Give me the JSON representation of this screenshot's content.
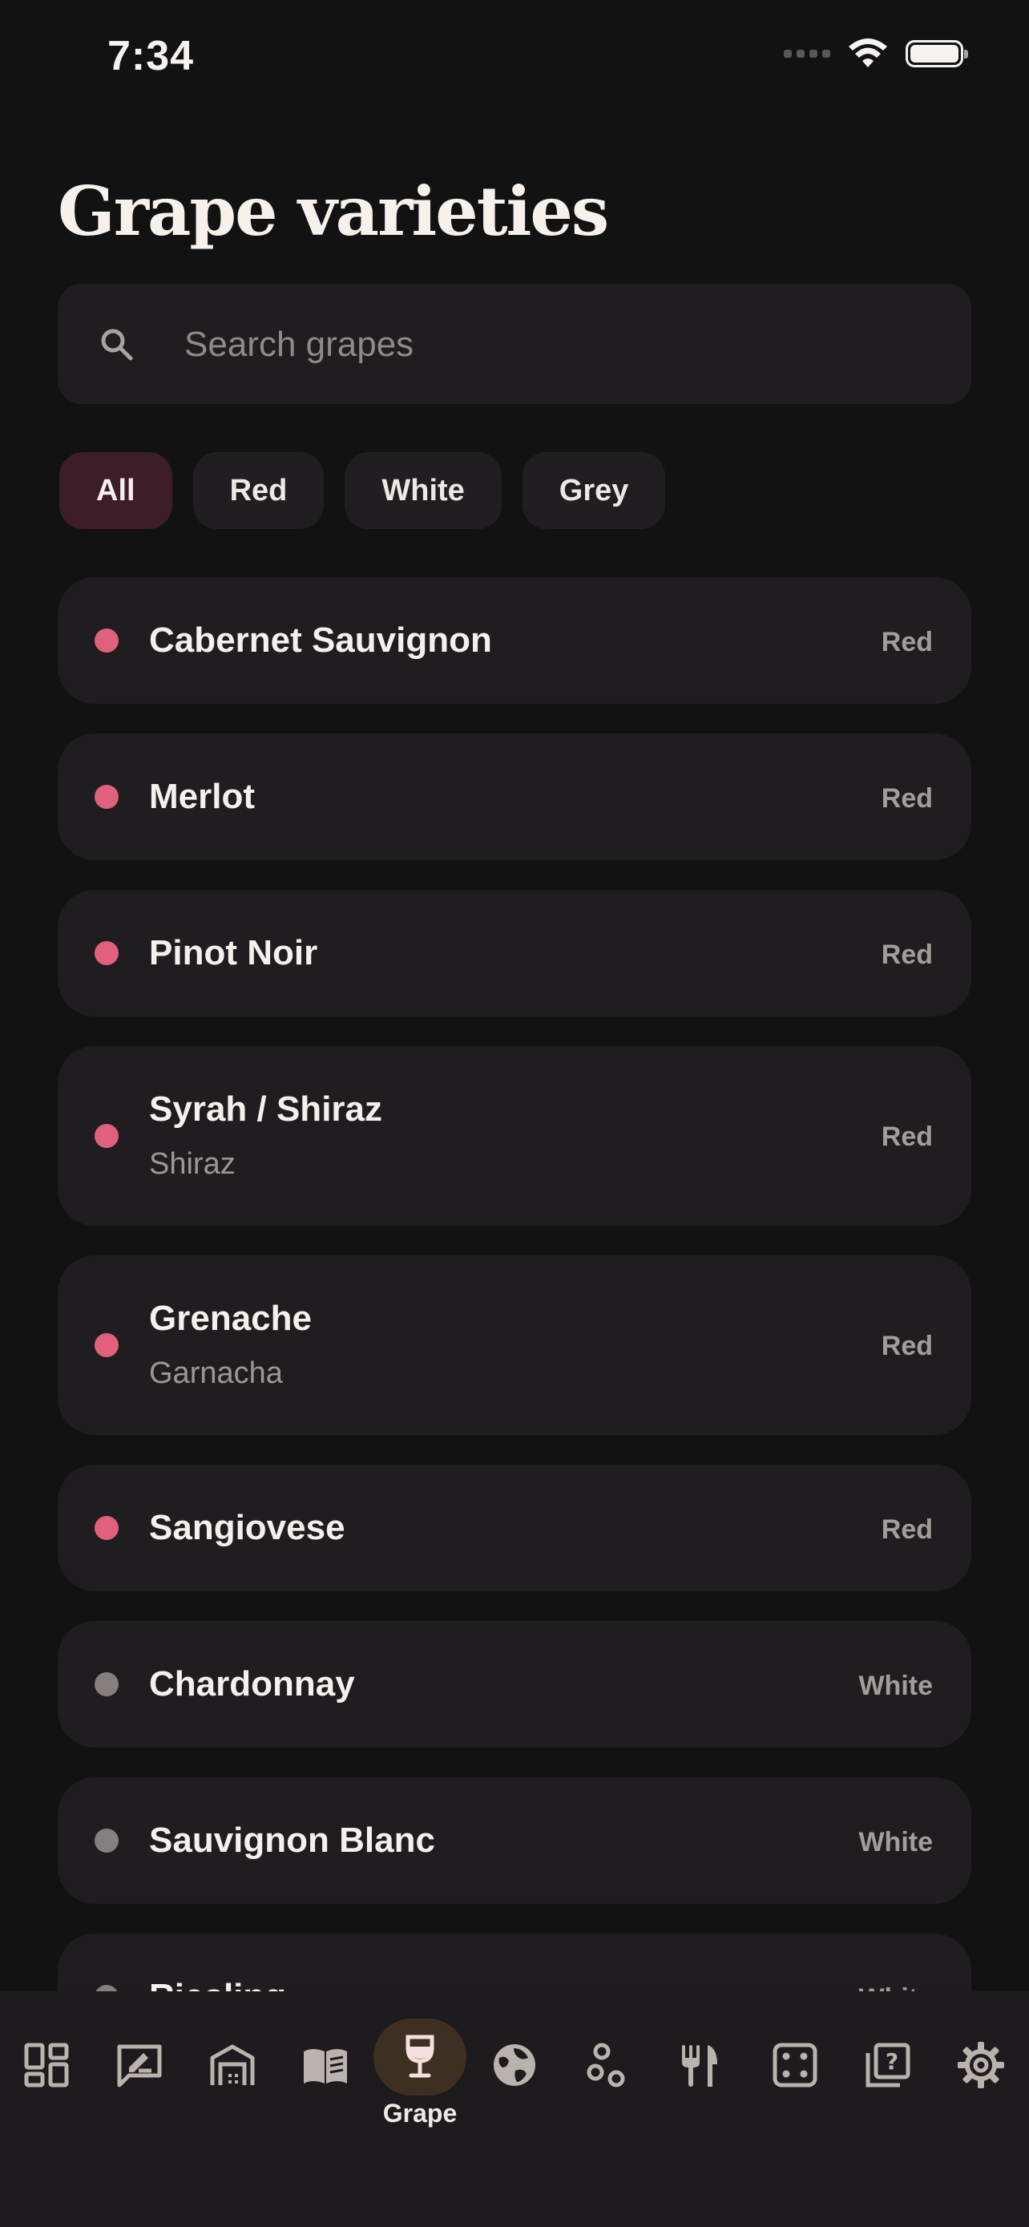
{
  "status": {
    "time": "7:34"
  },
  "page": {
    "title": "Grape varieties"
  },
  "search": {
    "placeholder": "Search grapes",
    "value": ""
  },
  "filters": [
    {
      "label": "All",
      "active": true
    },
    {
      "label": "Red",
      "active": false
    },
    {
      "label": "White",
      "active": false
    },
    {
      "label": "Grey",
      "active": false
    }
  ],
  "grapes": [
    {
      "name": "Cabernet Sauvignon",
      "alias": "",
      "color": "Red"
    },
    {
      "name": "Merlot",
      "alias": "",
      "color": "Red"
    },
    {
      "name": "Pinot Noir",
      "alias": "",
      "color": "Red"
    },
    {
      "name": "Syrah / Shiraz",
      "alias": "Shiraz",
      "color": "Red"
    },
    {
      "name": "Grenache",
      "alias": "Garnacha",
      "color": "Red"
    },
    {
      "name": "Sangiovese",
      "alias": "",
      "color": "Red"
    },
    {
      "name": "Chardonnay",
      "alias": "",
      "color": "White"
    },
    {
      "name": "Sauvignon Blanc",
      "alias": "",
      "color": "White"
    },
    {
      "name": "Riesling",
      "alias": "",
      "color": "White"
    }
  ],
  "tabbar": {
    "active_label": "Grape",
    "icons": [
      "dashboard-icon",
      "tasting-notes-icon",
      "cellar-icon",
      "guide-book-icon",
      "wine-glass-icon",
      "globe-icon",
      "pairing-icon",
      "food-icon",
      "dice-icon",
      "quiz-icon",
      "settings-icon"
    ]
  },
  "colors": {
    "background": "#131213",
    "card": "#1f1d1f",
    "red_dot": "#e0607e",
    "white_dot": "#85807f",
    "active_chip": "#3d1e28",
    "active_tab": "#3d3022"
  }
}
